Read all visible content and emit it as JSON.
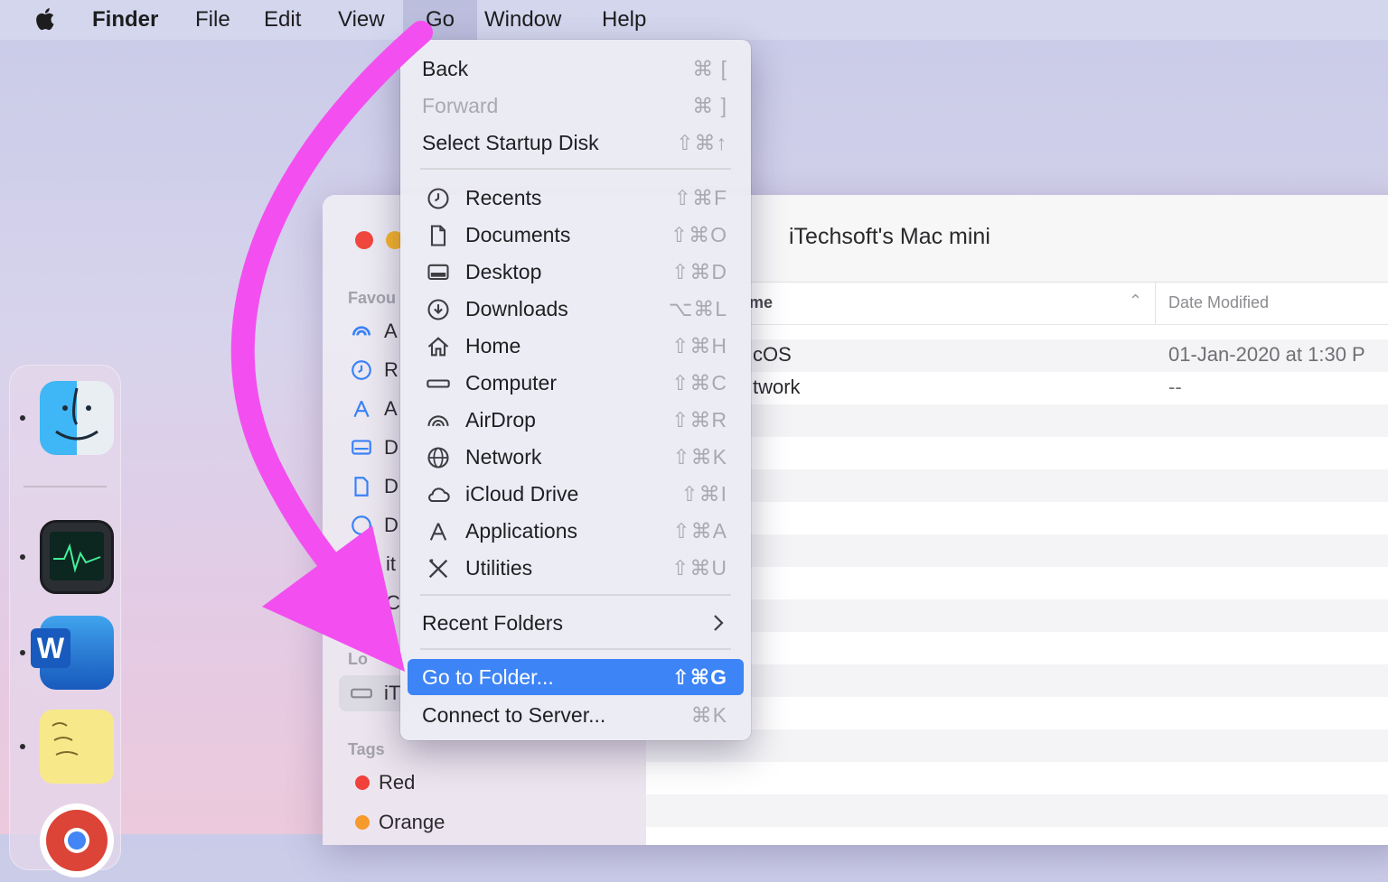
{
  "menubar": {
    "app": "Finder",
    "items": [
      "File",
      "Edit",
      "View",
      "Go",
      "Window",
      "Help"
    ]
  },
  "finder": {
    "title": "iTechsoft's Mac mini",
    "sidebar": {
      "favourites_heading": "Favou",
      "favourite_items": [
        "A",
        "R",
        "A",
        "D",
        "D",
        "D",
        "it",
        "C"
      ],
      "locations_heading": "Lo",
      "location_item": "iT",
      "tags_heading": "Tags",
      "tags": [
        {
          "name": "Red",
          "color": "#f0413b"
        },
        {
          "name": "Orange",
          "color": "#f59a2b"
        }
      ]
    },
    "columns": {
      "name": "me",
      "date": "Date Modified"
    },
    "rows": [
      {
        "name": "cOS",
        "date": "01-Jan-2020 at 1:30 P"
      },
      {
        "name": "twork",
        "date": "--"
      }
    ]
  },
  "go_menu": {
    "top": [
      {
        "label": "Back",
        "shortcut": "⌘ [",
        "enabled": true
      },
      {
        "label": "Forward",
        "shortcut": "⌘ ]",
        "enabled": false
      },
      {
        "label": "Select Startup Disk",
        "shortcut": "⇧⌘↑",
        "enabled": true
      }
    ],
    "places": [
      {
        "label": "Recents",
        "shortcut": "⇧⌘F",
        "icon": "clock-icon"
      },
      {
        "label": "Documents",
        "shortcut": "⇧⌘O",
        "icon": "document-icon"
      },
      {
        "label": "Desktop",
        "shortcut": "⇧⌘D",
        "icon": "desktop-icon"
      },
      {
        "label": "Downloads",
        "shortcut": "⌥⌘L",
        "icon": "download-icon"
      },
      {
        "label": "Home",
        "shortcut": "⇧⌘H",
        "icon": "home-icon"
      },
      {
        "label": "Computer",
        "shortcut": "⇧⌘C",
        "icon": "computer-icon"
      },
      {
        "label": "AirDrop",
        "shortcut": "⇧⌘R",
        "icon": "airdrop-icon"
      },
      {
        "label": "Network",
        "shortcut": "⇧⌘K",
        "icon": "network-icon"
      },
      {
        "label": "iCloud Drive",
        "shortcut": "⇧⌘I",
        "icon": "cloud-icon"
      },
      {
        "label": "Applications",
        "shortcut": "⇧⌘A",
        "icon": "applications-icon"
      },
      {
        "label": "Utilities",
        "shortcut": "⇧⌘U",
        "icon": "utilities-icon"
      }
    ],
    "recent_folders": "Recent Folders",
    "go_to_folder": {
      "label": "Go to Folder...",
      "shortcut": "⇧⌘G"
    },
    "connect": {
      "label": "Connect to Server...",
      "shortcut": "⌘K"
    }
  },
  "colors": {
    "highlight": "#3d84f6",
    "arrow": "#f34ff0"
  }
}
